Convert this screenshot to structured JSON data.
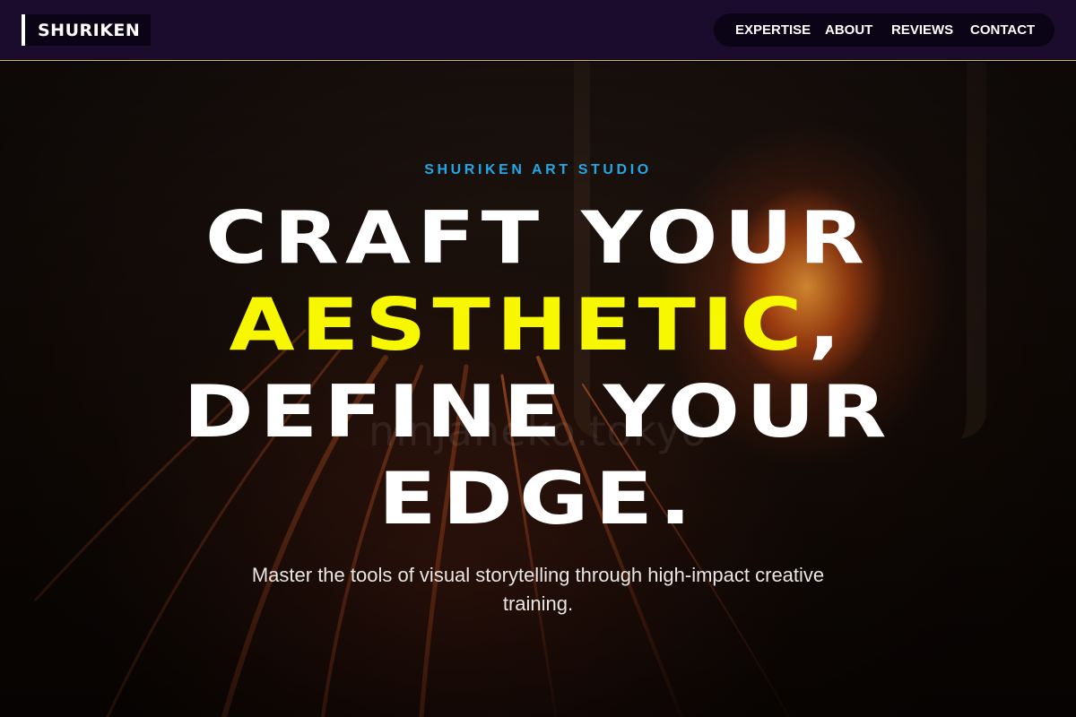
{
  "header": {
    "logo_text": "SHURIKEN",
    "nav": [
      {
        "label": "EXPERTISE"
      },
      {
        "label": "ABOUT"
      },
      {
        "label": "REVIEWS"
      },
      {
        "label": "CONTACT"
      }
    ]
  },
  "hero": {
    "eyebrow": "SHURIKEN ART STUDIO",
    "headline": {
      "line1": "CRAFT YOUR",
      "line2_highlight": "AESTHETIC",
      "line2_rest": ",",
      "line3": "DEFINE YOUR",
      "line4": "EDGE."
    },
    "subtitle": "Master the tools of visual storytelling through high-impact creative training.",
    "watermark": "ninjaneko.tokyo"
  },
  "colors": {
    "header_bg": "#1b0b2c",
    "nav_pill_bg": "#0b0416",
    "eyebrow": "#23a7e6",
    "accent": "#f7f700",
    "text": "#ffffff"
  }
}
